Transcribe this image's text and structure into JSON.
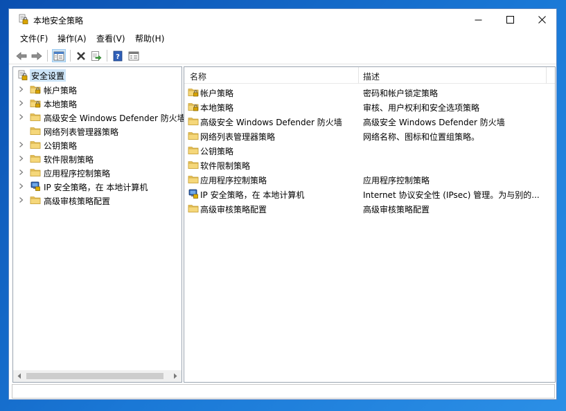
{
  "window": {
    "title": "本地安全策略"
  },
  "menu": [
    "文件(F)",
    "操作(A)",
    "查看(V)",
    "帮助(H)"
  ],
  "toolbar_icons": [
    "back-arrow-icon",
    "forward-arrow-icon",
    "show-hide-tree-icon",
    "delete-icon",
    "export-list-icon",
    "help-icon",
    "properties-icon"
  ],
  "tree": {
    "root": "安全设置",
    "items": [
      {
        "label": "帐户策略",
        "icon": "folder-lock-icon",
        "expandable": true
      },
      {
        "label": "本地策略",
        "icon": "folder-lock-icon",
        "expandable": true
      },
      {
        "label": "高级安全 Windows Defender 防火墙",
        "icon": "folder-icon",
        "expandable": true
      },
      {
        "label": "网络列表管理器策略",
        "icon": "folder-icon",
        "expandable": false
      },
      {
        "label": "公钥策略",
        "icon": "folder-icon",
        "expandable": true
      },
      {
        "label": "软件限制策略",
        "icon": "folder-icon",
        "expandable": true
      },
      {
        "label": "应用程序控制策略",
        "icon": "folder-icon",
        "expandable": true
      },
      {
        "label": "IP 安全策略，在 本地计算机",
        "icon": "ip-security-icon",
        "expandable": true
      },
      {
        "label": "高级审核策略配置",
        "icon": "folder-icon",
        "expandable": true
      }
    ]
  },
  "list": {
    "columns": [
      "名称",
      "描述"
    ],
    "rows": [
      {
        "name": "帐户策略",
        "desc": "密码和帐户锁定策略",
        "icon": "folder-lock-icon"
      },
      {
        "name": "本地策略",
        "desc": "审核、用户权利和安全选项策略",
        "icon": "folder-lock-icon"
      },
      {
        "name": "高级安全 Windows Defender 防火墙",
        "desc": "高级安全 Windows Defender 防火墙",
        "icon": "folder-icon"
      },
      {
        "name": "网络列表管理器策略",
        "desc": "网络名称、图标和位置组策略。",
        "icon": "folder-icon"
      },
      {
        "name": "公钥策略",
        "desc": "",
        "icon": "folder-icon"
      },
      {
        "name": "软件限制策略",
        "desc": "",
        "icon": "folder-icon"
      },
      {
        "name": "应用程序控制策略",
        "desc": "应用程序控制策略",
        "icon": "folder-icon"
      },
      {
        "name": "IP 安全策略，在 本地计算机",
        "desc": "Internet 协议安全性 (IPsec) 管理。为与别的...",
        "icon": "ip-security-icon"
      },
      {
        "name": "高级审核策略配置",
        "desc": "高级审核策略配置",
        "icon": "folder-icon"
      }
    ]
  },
  "colors": {
    "folder": "#e8c25a",
    "selection": "#cce4f7",
    "desktop": "#1a6fd0"
  }
}
